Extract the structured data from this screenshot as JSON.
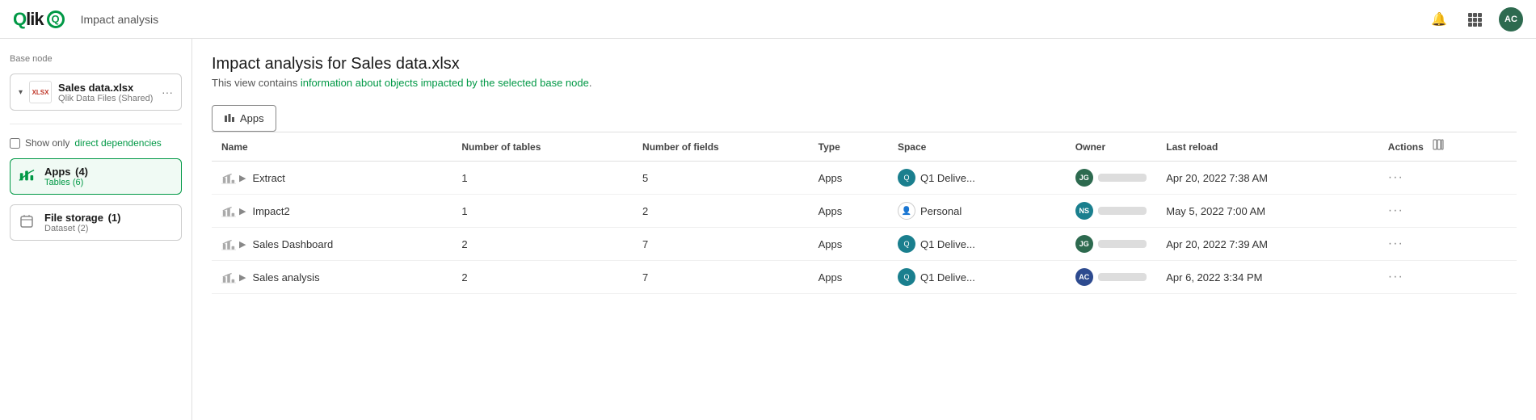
{
  "app": {
    "title": "Impact analysis",
    "logo_text": "Qlik",
    "avatar_label": "AC"
  },
  "topnav": {
    "bell_icon": "🔔",
    "grid_icon": "⠿",
    "avatar": "AC"
  },
  "sidebar": {
    "base_node_label": "Base node",
    "base_node": {
      "name": "Sales data.xlsx",
      "sub": "Qlik Data Files (Shared)"
    },
    "checkbox": {
      "label": "Show only",
      "link_text": "direct dependencies"
    },
    "tree_items": [
      {
        "label": "Apps",
        "count": "(4)",
        "sub": "Tables (6)",
        "active": true
      },
      {
        "label": "File storage",
        "count": "(1)",
        "sub": "Dataset (2)",
        "active": false
      }
    ]
  },
  "content": {
    "title": "Impact analysis for Sales data.xlsx",
    "subtitle_plain": "This view contains ",
    "subtitle_link": "information about objects impacted by the selected base node",
    "subtitle_end": "."
  },
  "tabs": [
    {
      "label": "Apps",
      "icon": "📊",
      "active": true
    }
  ],
  "table": {
    "columns": [
      "Name",
      "Number of tables",
      "Number of fields",
      "Type",
      "Space",
      "Owner",
      "Last reload",
      "Actions"
    ],
    "rows": [
      {
        "name": "Extract",
        "num_tables": "1",
        "num_fields": "5",
        "type": "Apps",
        "space": "Q1 Delive...",
        "space_type": "q1",
        "owner_initials": "JG",
        "owner_color": "#2d6a4f",
        "last_reload": "Apr 20, 2022 7:38 AM"
      },
      {
        "name": "Impact2",
        "num_tables": "1",
        "num_fields": "2",
        "type": "Apps",
        "space": "Personal",
        "space_type": "personal",
        "owner_initials": "NS",
        "owner_color": "#1a7f8e",
        "last_reload": "May 5, 2022 7:00 AM"
      },
      {
        "name": "Sales Dashboard",
        "num_tables": "2",
        "num_fields": "7",
        "type": "Apps",
        "space": "Q1 Delive...",
        "space_type": "q1",
        "owner_initials": "JG",
        "owner_color": "#2d6a4f",
        "last_reload": "Apr 20, 2022 7:39 AM"
      },
      {
        "name": "Sales analysis",
        "num_tables": "2",
        "num_fields": "7",
        "type": "Apps",
        "space": "Q1 Delive...",
        "space_type": "q1",
        "owner_initials": "AC",
        "owner_color": "#2d4a8f",
        "last_reload": "Apr 6, 2022 3:34 PM"
      }
    ]
  }
}
